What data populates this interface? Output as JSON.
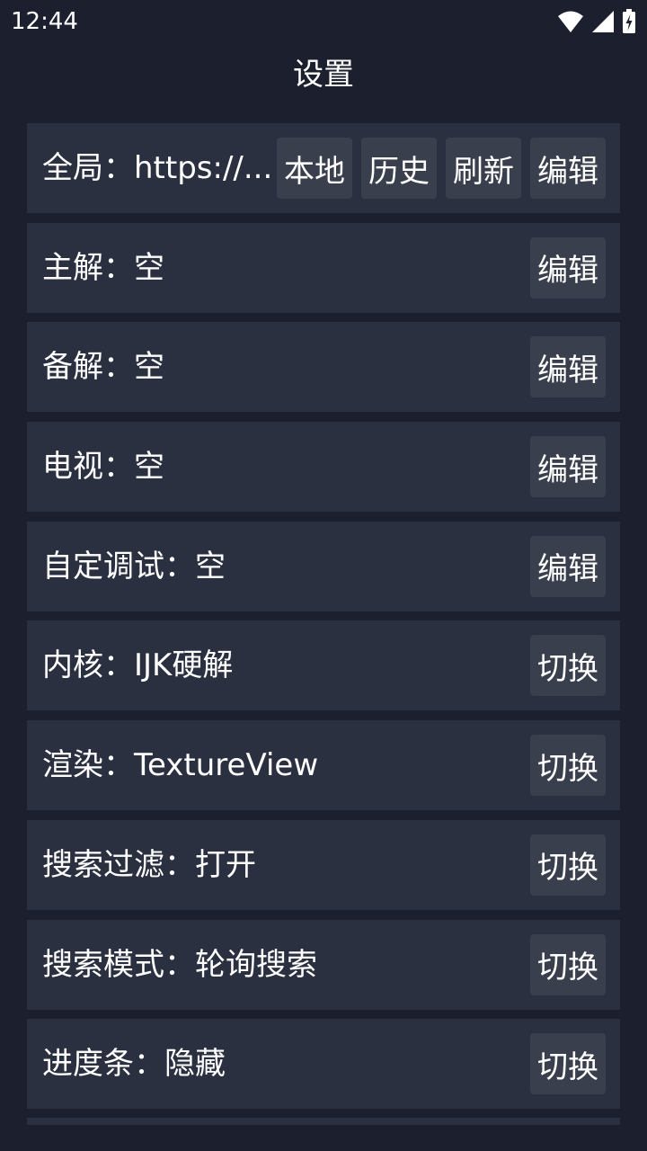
{
  "status_bar": {
    "time": "12:44",
    "icons": [
      "wifi-icon",
      "signal-icon",
      "battery-charging-icon"
    ]
  },
  "header": {
    "title": "设置"
  },
  "colors": {
    "background": "#1b1f2e",
    "row": "#2b3040",
    "button": "#3a3f4d",
    "text": "#ffffff"
  },
  "settings": [
    {
      "label": "全局：https://...",
      "buttons": [
        "本地",
        "历史",
        "刷新",
        "编辑"
      ]
    },
    {
      "label": "主解：空",
      "buttons": [
        "编辑"
      ]
    },
    {
      "label": "备解：空",
      "buttons": [
        "编辑"
      ]
    },
    {
      "label": "电视：空",
      "buttons": [
        "编辑"
      ]
    },
    {
      "label": "自定调试：空",
      "buttons": [
        "编辑"
      ]
    },
    {
      "label": "内核：IJK硬解",
      "buttons": [
        "切换"
      ]
    },
    {
      "label": "渲染：TextureView",
      "buttons": [
        "切换"
      ]
    },
    {
      "label": "搜索过滤：打开",
      "buttons": [
        "切换"
      ]
    },
    {
      "label": "搜索模式：轮询搜索",
      "buttons": [
        "切换"
      ]
    },
    {
      "label": "进度条：隐藏",
      "buttons": [
        "切换"
      ]
    }
  ]
}
